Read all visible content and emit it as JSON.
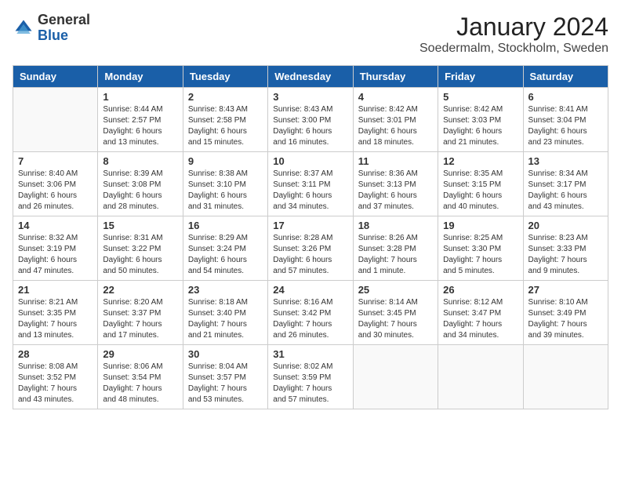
{
  "logo": {
    "general": "General",
    "blue": "Blue"
  },
  "title": "January 2024",
  "location": "Soedermalm, Stockholm, Sweden",
  "weekdays": [
    "Sunday",
    "Monday",
    "Tuesday",
    "Wednesday",
    "Thursday",
    "Friday",
    "Saturday"
  ],
  "weeks": [
    [
      {
        "day": "",
        "info": ""
      },
      {
        "day": "1",
        "info": "Sunrise: 8:44 AM\nSunset: 2:57 PM\nDaylight: 6 hours\nand 13 minutes."
      },
      {
        "day": "2",
        "info": "Sunrise: 8:43 AM\nSunset: 2:58 PM\nDaylight: 6 hours\nand 15 minutes."
      },
      {
        "day": "3",
        "info": "Sunrise: 8:43 AM\nSunset: 3:00 PM\nDaylight: 6 hours\nand 16 minutes."
      },
      {
        "day": "4",
        "info": "Sunrise: 8:42 AM\nSunset: 3:01 PM\nDaylight: 6 hours\nand 18 minutes."
      },
      {
        "day": "5",
        "info": "Sunrise: 8:42 AM\nSunset: 3:03 PM\nDaylight: 6 hours\nand 21 minutes."
      },
      {
        "day": "6",
        "info": "Sunrise: 8:41 AM\nSunset: 3:04 PM\nDaylight: 6 hours\nand 23 minutes."
      }
    ],
    [
      {
        "day": "7",
        "info": "Sunrise: 8:40 AM\nSunset: 3:06 PM\nDaylight: 6 hours\nand 26 minutes."
      },
      {
        "day": "8",
        "info": "Sunrise: 8:39 AM\nSunset: 3:08 PM\nDaylight: 6 hours\nand 28 minutes."
      },
      {
        "day": "9",
        "info": "Sunrise: 8:38 AM\nSunset: 3:10 PM\nDaylight: 6 hours\nand 31 minutes."
      },
      {
        "day": "10",
        "info": "Sunrise: 8:37 AM\nSunset: 3:11 PM\nDaylight: 6 hours\nand 34 minutes."
      },
      {
        "day": "11",
        "info": "Sunrise: 8:36 AM\nSunset: 3:13 PM\nDaylight: 6 hours\nand 37 minutes."
      },
      {
        "day": "12",
        "info": "Sunrise: 8:35 AM\nSunset: 3:15 PM\nDaylight: 6 hours\nand 40 minutes."
      },
      {
        "day": "13",
        "info": "Sunrise: 8:34 AM\nSunset: 3:17 PM\nDaylight: 6 hours\nand 43 minutes."
      }
    ],
    [
      {
        "day": "14",
        "info": "Sunrise: 8:32 AM\nSunset: 3:19 PM\nDaylight: 6 hours\nand 47 minutes."
      },
      {
        "day": "15",
        "info": "Sunrise: 8:31 AM\nSunset: 3:22 PM\nDaylight: 6 hours\nand 50 minutes."
      },
      {
        "day": "16",
        "info": "Sunrise: 8:29 AM\nSunset: 3:24 PM\nDaylight: 6 hours\nand 54 minutes."
      },
      {
        "day": "17",
        "info": "Sunrise: 8:28 AM\nSunset: 3:26 PM\nDaylight: 6 hours\nand 57 minutes."
      },
      {
        "day": "18",
        "info": "Sunrise: 8:26 AM\nSunset: 3:28 PM\nDaylight: 7 hours\nand 1 minute."
      },
      {
        "day": "19",
        "info": "Sunrise: 8:25 AM\nSunset: 3:30 PM\nDaylight: 7 hours\nand 5 minutes."
      },
      {
        "day": "20",
        "info": "Sunrise: 8:23 AM\nSunset: 3:33 PM\nDaylight: 7 hours\nand 9 minutes."
      }
    ],
    [
      {
        "day": "21",
        "info": "Sunrise: 8:21 AM\nSunset: 3:35 PM\nDaylight: 7 hours\nand 13 minutes."
      },
      {
        "day": "22",
        "info": "Sunrise: 8:20 AM\nSunset: 3:37 PM\nDaylight: 7 hours\nand 17 minutes."
      },
      {
        "day": "23",
        "info": "Sunrise: 8:18 AM\nSunset: 3:40 PM\nDaylight: 7 hours\nand 21 minutes."
      },
      {
        "day": "24",
        "info": "Sunrise: 8:16 AM\nSunset: 3:42 PM\nDaylight: 7 hours\nand 26 minutes."
      },
      {
        "day": "25",
        "info": "Sunrise: 8:14 AM\nSunset: 3:45 PM\nDaylight: 7 hours\nand 30 minutes."
      },
      {
        "day": "26",
        "info": "Sunrise: 8:12 AM\nSunset: 3:47 PM\nDaylight: 7 hours\nand 34 minutes."
      },
      {
        "day": "27",
        "info": "Sunrise: 8:10 AM\nSunset: 3:49 PM\nDaylight: 7 hours\nand 39 minutes."
      }
    ],
    [
      {
        "day": "28",
        "info": "Sunrise: 8:08 AM\nSunset: 3:52 PM\nDaylight: 7 hours\nand 43 minutes."
      },
      {
        "day": "29",
        "info": "Sunrise: 8:06 AM\nSunset: 3:54 PM\nDaylight: 7 hours\nand 48 minutes."
      },
      {
        "day": "30",
        "info": "Sunrise: 8:04 AM\nSunset: 3:57 PM\nDaylight: 7 hours\nand 53 minutes."
      },
      {
        "day": "31",
        "info": "Sunrise: 8:02 AM\nSunset: 3:59 PM\nDaylight: 7 hours\nand 57 minutes."
      },
      {
        "day": "",
        "info": ""
      },
      {
        "day": "",
        "info": ""
      },
      {
        "day": "",
        "info": ""
      }
    ]
  ]
}
